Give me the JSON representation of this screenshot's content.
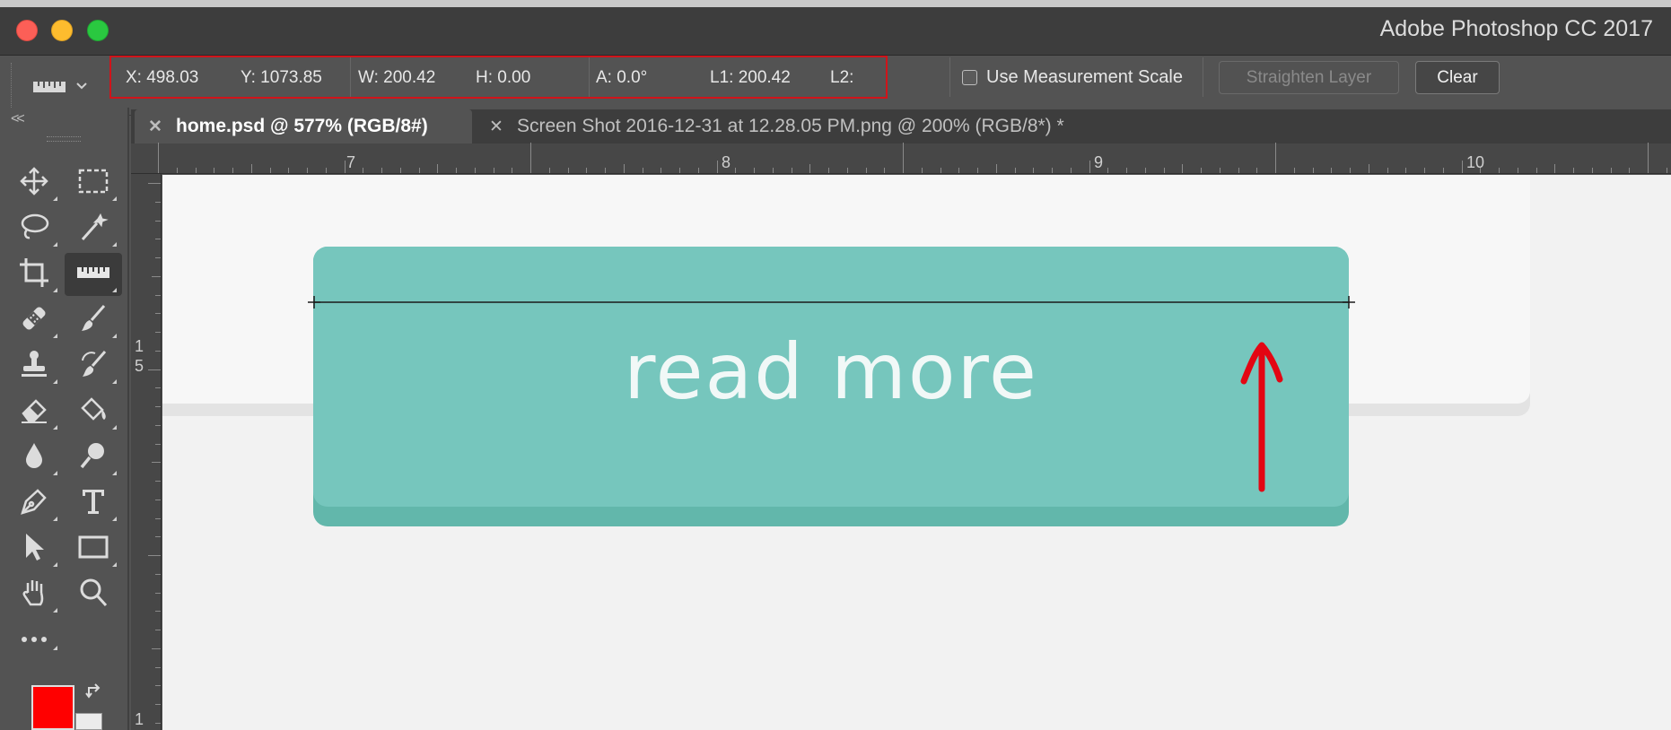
{
  "window": {
    "title": "Adobe Photoshop CC 2017",
    "controls": [
      "close",
      "minimize",
      "zoom"
    ]
  },
  "options_bar": {
    "tool_icon": "ruler-icon",
    "x": "X: 498.03",
    "y": "Y: 1073.85",
    "w": "W: 200.42",
    "h": "H: 0.00",
    "a": "A: 0.0°",
    "l1": "L1: 200.42",
    "l2": "L2:",
    "use_measurement_scale": "Use Measurement Scale",
    "use_measurement_scale_checked": false,
    "straighten_layer": "Straighten Layer",
    "clear": "Clear",
    "highlight_color": "#d0141a"
  },
  "tabs": [
    {
      "label": "home.psd @ 577% (RGB/8#)",
      "active": true
    },
    {
      "label": "Screen Shot 2016-12-31 at 12.28.05 PM.png @ 200% (RGB/8*) *",
      "active": false
    }
  ],
  "toolbar": {
    "collapse": "<<",
    "tools": [
      "move-icon",
      "marquee-icon",
      "lasso-icon",
      "magic-wand-icon",
      "crop-icon",
      "ruler-icon",
      "healing-brush-icon",
      "brush-icon",
      "clone-stamp-icon",
      "history-brush-icon",
      "eraser-icon",
      "paint-bucket-icon",
      "blur-icon",
      "dodge-icon",
      "pen-icon",
      "type-icon",
      "path-selection-icon",
      "rectangle-icon",
      "hand-icon",
      "zoom-icon",
      "more-icon"
    ],
    "selected_tool": "ruler-icon",
    "foreground_color": "#ff0000",
    "background_color": "#ebebeb"
  },
  "rulers": {
    "horizontal_labels": [
      "7",
      "8",
      "9",
      "10"
    ],
    "vertical_labels": [
      "1",
      "5",
      "1"
    ]
  },
  "canvas": {
    "button_text": "read more",
    "button_color": "#76c6bd",
    "annotation": "red-up-arrow",
    "annotation_color": "#e30613"
  }
}
